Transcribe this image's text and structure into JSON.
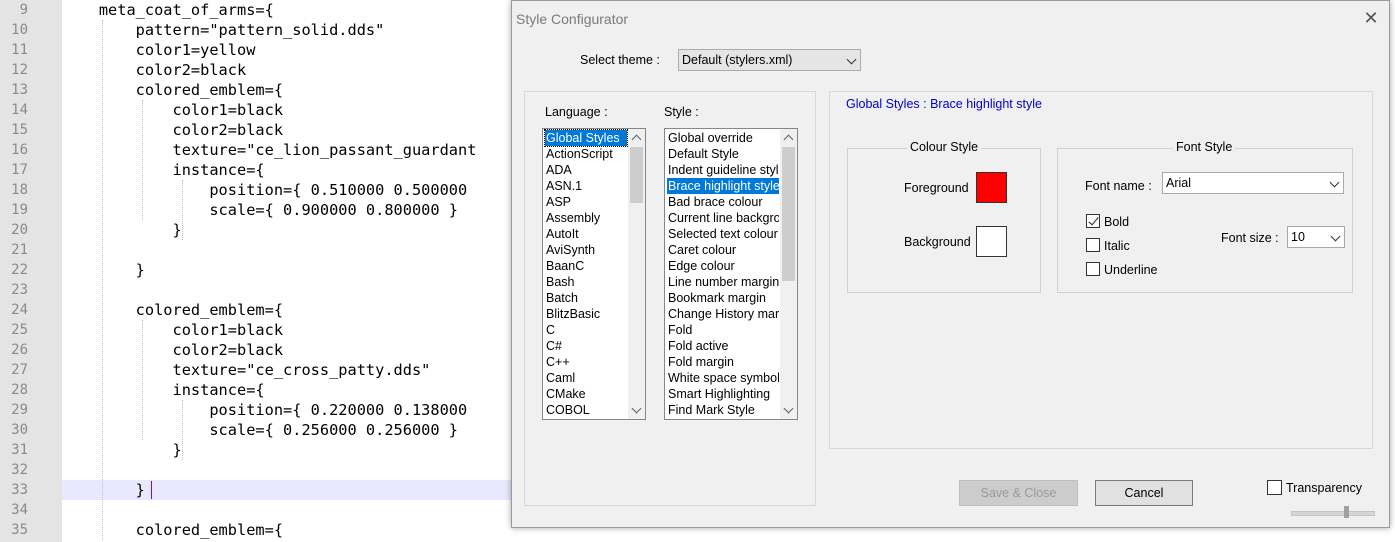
{
  "editor": {
    "line_numbers": [
      "9",
      "10",
      "11",
      "12",
      "13",
      "14",
      "15",
      "16",
      "17",
      "18",
      "19",
      "20",
      "21",
      "22",
      "23",
      "24",
      "25",
      "26",
      "27",
      "28",
      "29",
      "30",
      "31",
      "32",
      "33",
      "34",
      "35"
    ],
    "lines": [
      "    meta_coat_of_arms={",
      "        pattern=\"pattern_solid.dds\"",
      "        color1=yellow",
      "        color2=black",
      "        colored_emblem={",
      "            color1=black",
      "            color2=black",
      "            texture=\"ce_lion_passant_guardant",
      "            instance={",
      "                position={ 0.510000 0.500000",
      "                scale={ 0.900000 0.800000 }",
      "            }",
      "",
      "        }",
      "",
      "        colored_emblem={",
      "            color1=black",
      "            color2=black",
      "            texture=\"ce_cross_patty.dds\"",
      "            instance={",
      "                position={ 0.220000 0.138000",
      "                scale={ 0.256000 0.256000 }",
      "            }",
      "",
      "        }",
      "",
      "        colored_emblem={"
    ]
  },
  "dialog": {
    "title": "Style Configurator",
    "close_icon": "close-icon",
    "select_theme_label": "Select theme :",
    "theme_value": "Default (stylers.xml)",
    "language_label": "Language :",
    "style_label": "Style :",
    "languages": [
      "Global Styles",
      "ActionScript",
      "ADA",
      "ASN.1",
      "ASP",
      "Assembly",
      "AutoIt",
      "AviSynth",
      "BaanC",
      "Bash",
      "Batch",
      "BlitzBasic",
      "C",
      "C#",
      "C++",
      "Caml",
      "CMake",
      "COBOL"
    ],
    "selected_language": "Global Styles",
    "styles": [
      "Global override",
      "Default Style",
      "Indent guideline style",
      "Brace highlight style",
      "Bad brace colour",
      "Current line background",
      "Selected text colour",
      "Caret colour",
      "Edge colour",
      "Line number margin",
      "Bookmark margin",
      "Change History margin",
      "Fold",
      "Fold active",
      "Fold margin",
      "White space symbol",
      "Smart Highlighting",
      "Find Mark Style"
    ],
    "selected_style": "Brace highlight style",
    "heading": "Global Styles : Brace highlight style",
    "colour_style_title": "Colour Style",
    "foreground_label": "Foreground",
    "background_label": "Background",
    "foreground_color": "#ff0000",
    "background_color": "#ffffff",
    "font_style_title": "Font Style",
    "font_name_label": "Font name :",
    "font_name_value": "Arial",
    "bold_label": "Bold",
    "italic_label": "Italic",
    "underline_label": "Underline",
    "bold_checked": true,
    "italic_checked": false,
    "underline_checked": false,
    "font_size_label": "Font size :",
    "font_size_value": "10",
    "save_close_label": "Save & Close",
    "cancel_label": "Cancel",
    "transparency_label": "Transparency",
    "accent_color": "#0078d7"
  }
}
